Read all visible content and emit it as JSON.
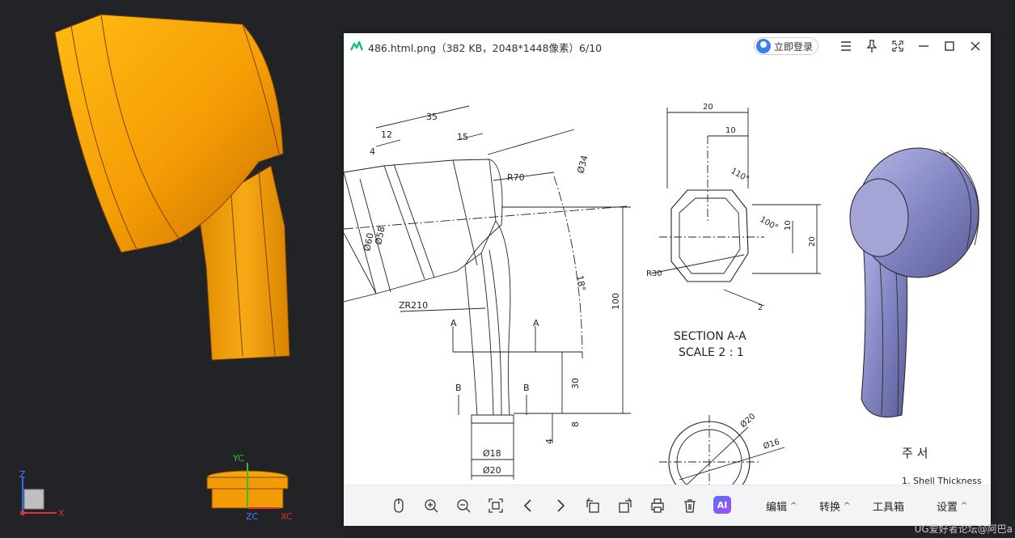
{
  "viewer": {
    "title": "486.html.png（382 KB，2048*1448像素）6/10",
    "login_label": "立即登录"
  },
  "drawing": {
    "dims": [
      "35",
      "12",
      "15",
      "4",
      "R70",
      "Ø34",
      "Ø60",
      "Ø58",
      "18°",
      "ZR210",
      "100",
      "30",
      "8",
      "4",
      "Ø18",
      "Ø20"
    ],
    "section_labels": [
      "A",
      "A",
      "B",
      "B"
    ],
    "section_dims": [
      "20",
      "10",
      "110°",
      "100°",
      "10",
      "20",
      "R30",
      "2"
    ],
    "section_title": "SECTION A-A",
    "section_scale": "SCALE 2 : 1",
    "circle_dims": [
      "Ø20",
      "Ø16"
    ],
    "notes_title": "주 서",
    "notes_line1": "1. Shell Thickness"
  },
  "toolbar": {
    "edit_label": "编辑",
    "convert_label": "转换",
    "tools_label": "工具箱",
    "settings_label": "设置",
    "ai_label": "AI"
  },
  "triad_left": {
    "z": "Z",
    "x": "X"
  },
  "triad_right": {
    "yc": "YC",
    "zc": "ZC",
    "xc": "XC"
  },
  "watermark": "UG爱好者论坛@阿巴a",
  "colors": {
    "cad_background": "#212327",
    "part_orange": "#f5a20a",
    "part_purple": "#8a8cc4"
  }
}
